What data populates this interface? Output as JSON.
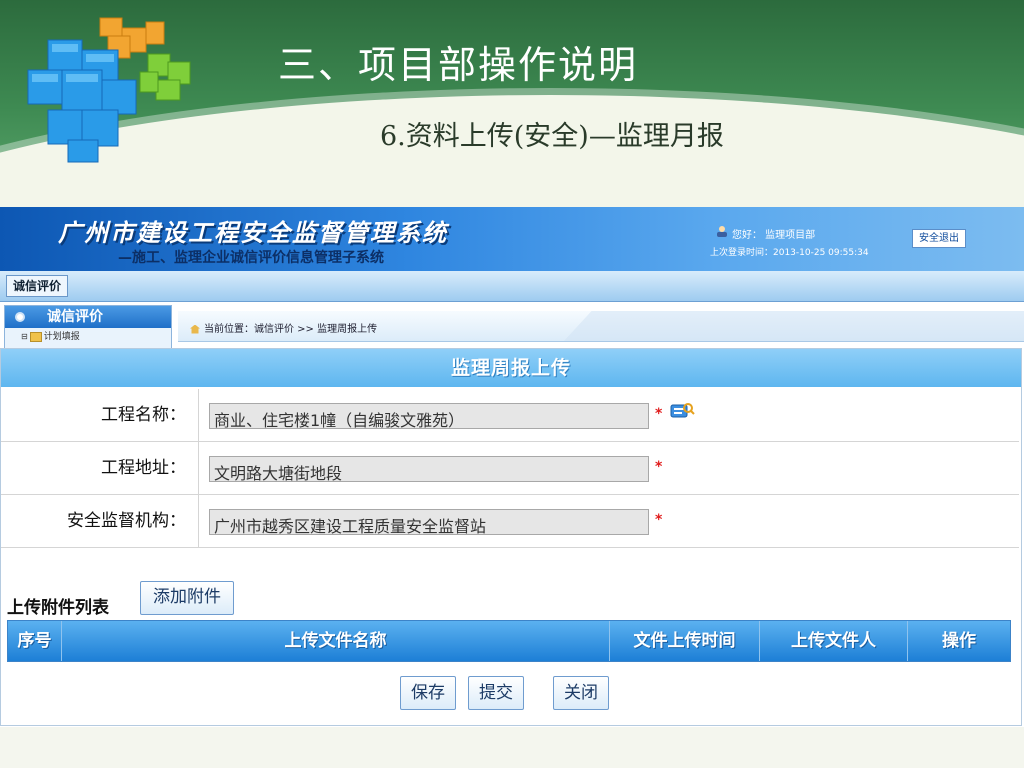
{
  "slide": {
    "title": "三、项目部操作说明",
    "subtitle": "6.资料上传(安全)—监理月报"
  },
  "app": {
    "system_title": "广州市建设工程安全监督管理系统",
    "system_subtitle": "—施工、监理企业诚信评价信息管理子系统",
    "user_greeting": "您好： 监理项目部",
    "last_login": "上次登录时间：2013-10-25 09:55:34",
    "logout_label": "安全退出",
    "nav_tab": "诚信评价",
    "sidebar": {
      "header": "诚信评价",
      "item": "计划填报"
    },
    "breadcrumb": "当前位置：诚信评价 >> 监理周报上传",
    "form": {
      "title": "监理周报上传",
      "fields": [
        {
          "label": "工程名称：",
          "value": "商业、住宅楼1幢（自编骏文雅苑）",
          "required": "*"
        },
        {
          "label": "工程地址：",
          "value": "文明路大塘街地段",
          "required": "*"
        },
        {
          "label": "安全监督机构：",
          "value": "广州市越秀区建设工程质量安全监督站",
          "required": "*"
        }
      ],
      "attachments_label": "上传附件列表",
      "add_attachment_label": "添加附件",
      "table_headers": [
        "序号",
        "上传文件名称",
        "文件上传时间",
        "上传文件人",
        "操作"
      ],
      "buttons": {
        "save": "保存",
        "submit": "提交",
        "close": "关闭"
      }
    }
  },
  "colors": {
    "slide_green": "#3e8a52",
    "header_blue": "#1f6fc8",
    "table_head_blue": "#1d7fd6",
    "required_red": "#e01c1c"
  }
}
